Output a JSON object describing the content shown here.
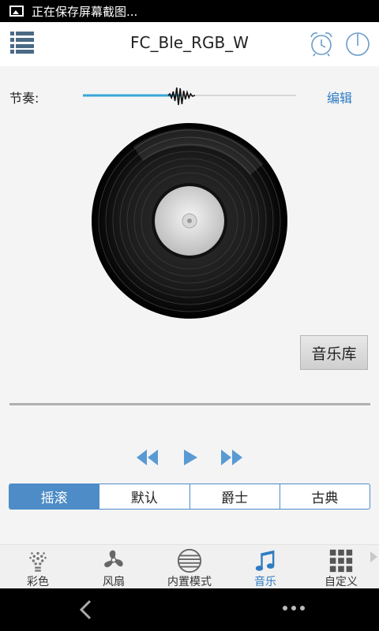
{
  "status_bar": {
    "notification": "正在保存屏幕截图..."
  },
  "app_bar": {
    "title": "FC_Ble_RGB_W"
  },
  "rhythm": {
    "label": "节奏:",
    "edit_label": "编辑",
    "level": 0.46
  },
  "library_button": "音乐库",
  "modes": [
    {
      "label": "摇滚",
      "active": true
    },
    {
      "label": "默认",
      "active": false
    },
    {
      "label": "爵士",
      "active": false
    },
    {
      "label": "古典",
      "active": false
    }
  ],
  "tabs": [
    {
      "label": "彩色",
      "icon": "bulb-icon",
      "active": false
    },
    {
      "label": "风扇",
      "icon": "fan-icon",
      "active": false
    },
    {
      "label": "内置模式",
      "icon": "lines-globe-icon",
      "active": false
    },
    {
      "label": "音乐",
      "icon": "music-note-icon",
      "active": true
    },
    {
      "label": "自定义",
      "icon": "grid-icon",
      "active": false
    }
  ],
  "colors": {
    "accent": "#2e7cc4",
    "segment_active": "#4d8cc6",
    "slider_fill": "#3aa6d8"
  }
}
